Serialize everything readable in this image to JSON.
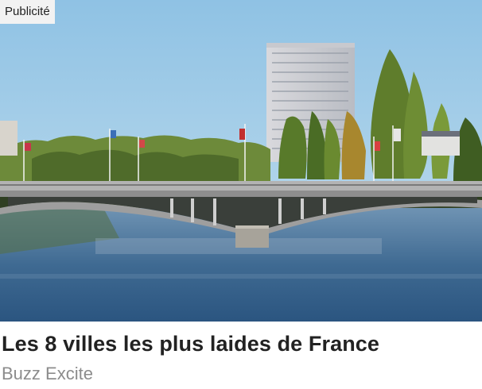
{
  "ad": {
    "badge_label": "Publicité",
    "title": "Les 8 villes les plus laides de France",
    "source": "Buzz Excite",
    "image_icon": "photo-river-bridge-city"
  },
  "colors": {
    "sky": "#a8d0ea",
    "water": "#3c6a94",
    "title_text": "#222222",
    "source_text": "#8c8c8c",
    "badge_bg": "#f2f2f2"
  }
}
